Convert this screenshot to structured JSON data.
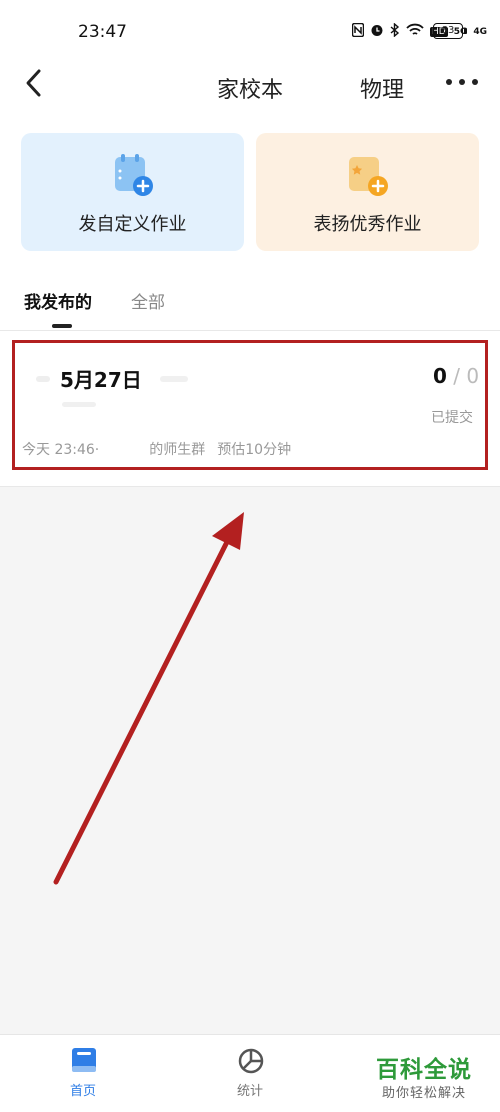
{
  "status_bar": {
    "time": "23:47",
    "icons": [
      "nfc-icon",
      "alarm-icon",
      "bluetooth-icon",
      "wifi-icon",
      "hd-icon",
      "signal-5g-icon",
      "signal-4g-icon"
    ],
    "hd_label": "HD",
    "net1": "5G",
    "net2": "4G",
    "battery": "83"
  },
  "nav": {
    "title": "家校本",
    "subject": "物理"
  },
  "actions": [
    {
      "label": "发自定义作业",
      "color": "#e3f1fd",
      "icon": "custom-homework-icon"
    },
    {
      "label": "表扬优秀作业",
      "color": "#fdf0e1",
      "icon": "praise-homework-icon"
    }
  ],
  "tabs": [
    {
      "label": "我发布的",
      "active": true
    },
    {
      "label": "全部",
      "active": false
    }
  ],
  "assignment": {
    "title": "5月27日",
    "submitted": "0",
    "separator": "/",
    "total": "0",
    "status": "已提交",
    "time": "今天 23:46·",
    "group": "的师生群",
    "estimate": "预估10分钟"
  },
  "bottom_nav": [
    {
      "label": "首页",
      "active": true,
      "icon": "book-icon"
    },
    {
      "label": "统计",
      "active": false,
      "icon": "pie-chart-icon"
    }
  ],
  "watermark": {
    "title": "百科全说",
    "subtitle": "助你轻松解决"
  },
  "colors": {
    "accent": "#2f7ee6",
    "annotation": "#b32020",
    "watermark": "#2e9a3a"
  }
}
